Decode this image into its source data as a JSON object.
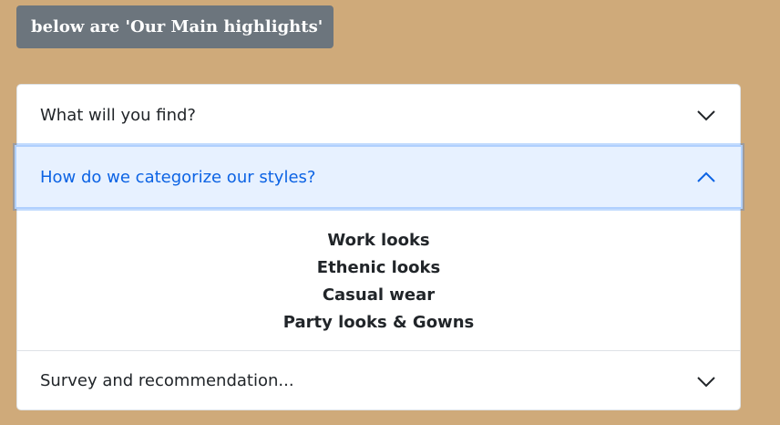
{
  "badge": {
    "label": "below are 'Our Main highlights'"
  },
  "accordion": {
    "items": [
      {
        "title": "What will you find?",
        "expanded": false,
        "icon": "chevron-down-icon"
      },
      {
        "title": "How do we categorize our styles?",
        "expanded": true,
        "icon": "chevron-up-icon",
        "body_lines": [
          "Work looks",
          "Ethenic looks",
          "Casual wear",
          "Party looks & Gowns"
        ]
      },
      {
        "title": "Survey and recommendation...",
        "expanded": false,
        "icon": "chevron-down-icon"
      }
    ]
  },
  "colors": {
    "page_background": "#cfaa7a",
    "badge_background": "#6c757d",
    "active_header_background": "#e7f1ff",
    "active_header_text": "#0c63e4"
  }
}
